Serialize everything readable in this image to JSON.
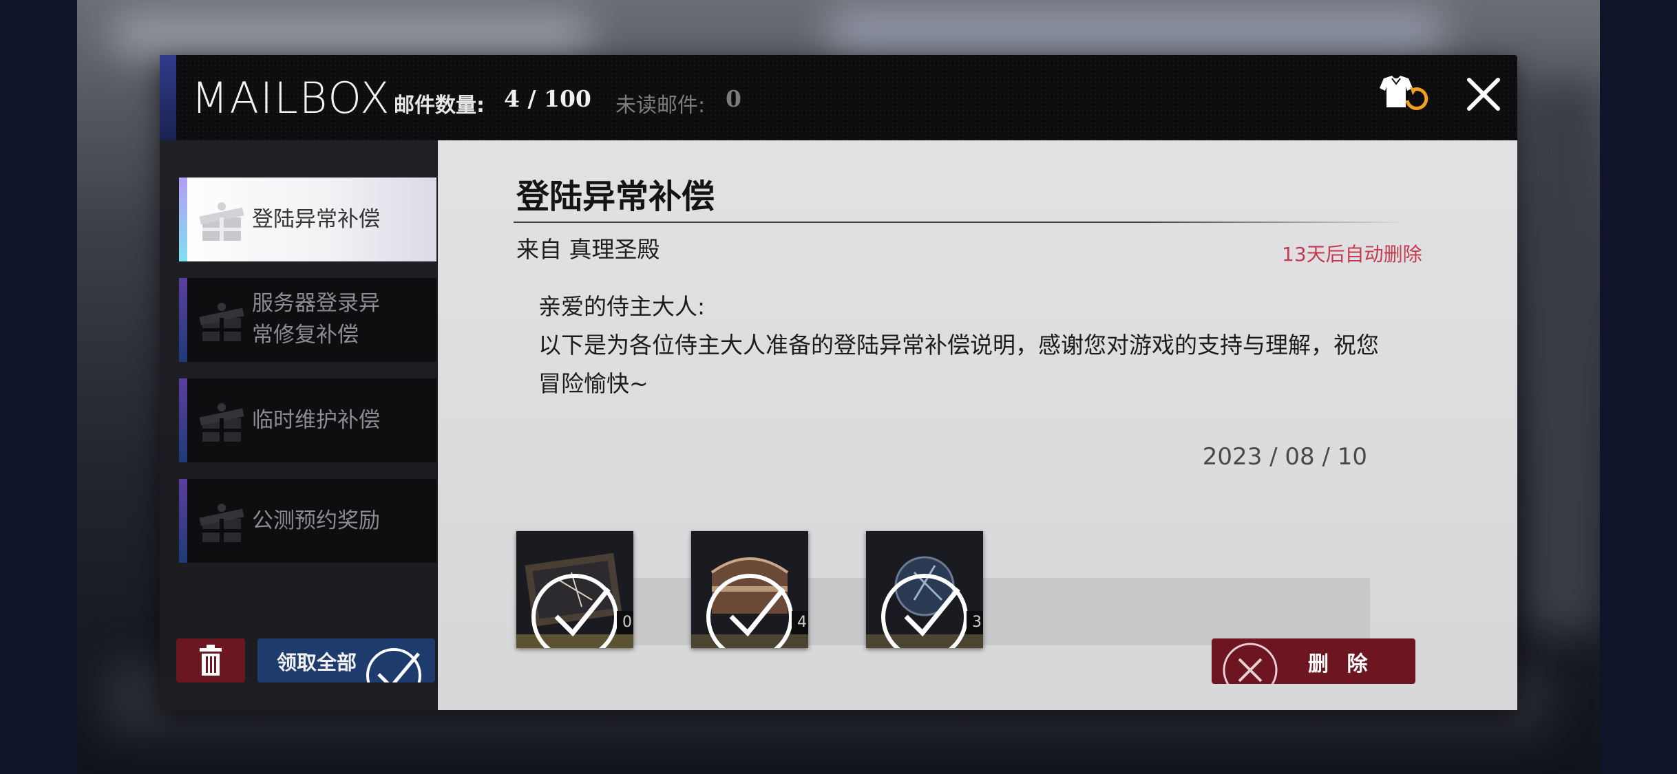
{
  "header": {
    "title": "MAILBOX",
    "mail_count_label": "邮件数量:",
    "mail_count_value": "4 / 100",
    "unread_label": "未读邮件:",
    "unread_value": "0"
  },
  "mail_list": [
    {
      "title": "登陆异常补偿",
      "active": true
    },
    {
      "title": "服务器登录异常修复补偿",
      "line1": "服务器登录异",
      "line2": "常修复补偿",
      "active": false
    },
    {
      "title": "临时维护补偿",
      "active": false
    },
    {
      "title": "公测预约奖励",
      "active": false
    }
  ],
  "footer": {
    "claim_all_label": "领取全部"
  },
  "mail": {
    "title": "登陆异常补偿",
    "sender": "来自 真理圣殿",
    "expire_note": "13天后自动删除",
    "greeting": "亲爱的侍主大人:",
    "body": "以下是为各位侍主大人准备的登陆异常补偿说明，感谢您对游戏的支持与理解，祝您冒险愉快~",
    "date": "2023 / 08 / 10",
    "rewards": [
      {
        "icon": "ticket-item-icon",
        "qty": "0",
        "claimed": true
      },
      {
        "icon": "treasure-chest-item-icon",
        "qty": "4",
        "claimed": true
      },
      {
        "icon": "orb-item-icon",
        "qty": "3",
        "claimed": true
      }
    ],
    "delete_label": "删 除"
  },
  "colors": {
    "expire_text": "#c23b4e",
    "claim_button": "#1d3b6c",
    "delete_button": "#6e1522",
    "trash_button": "#6a1721",
    "outfit_icon_accent": "#f0a020"
  }
}
